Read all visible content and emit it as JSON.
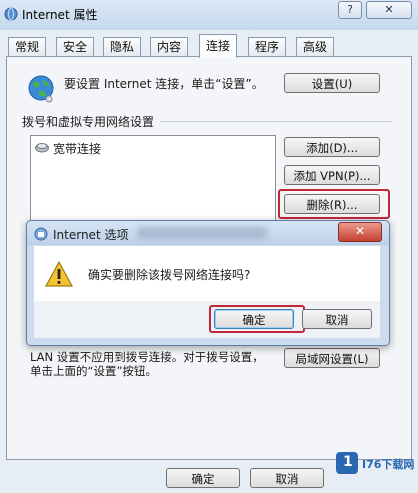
{
  "window": {
    "title": "Internet 属性",
    "help_glyph": "?",
    "close_glyph": "✕"
  },
  "tabs": [
    {
      "label": "常规"
    },
    {
      "label": "安全"
    },
    {
      "label": "隐私"
    },
    {
      "label": "内容"
    },
    {
      "label": "连接"
    },
    {
      "label": "程序"
    },
    {
      "label": "高级"
    }
  ],
  "connection": {
    "setup_text": "要设置 Internet 连接，单击“设置”。",
    "setup_button": "设置(U)",
    "dialup_group_label": "拨号和虚拟专用网络设置",
    "list_items": [
      "宽带连接"
    ],
    "add_button": "添加(D)...",
    "add_vpn_button": "添加 VPN(P)...",
    "remove_button": "删除(R)...",
    "lan_text": "LAN 设置不应用到拨号连接。对于拨号设置，单击上面的“设置”按钮。",
    "lan_button": "局域网设置(L)"
  },
  "footer": {
    "ok_button": "确定",
    "cancel_button": "取消"
  },
  "dialog": {
    "title": "Internet 选项",
    "close_glyph": "✕",
    "message": "确实要删除该拨号网络连接吗?",
    "ok_button": "确定",
    "cancel_button": "取消"
  },
  "watermark": {
    "brand": "I76下载网",
    "logo_letter": "1"
  },
  "colors": {
    "highlight": "#c0283a",
    "accent": "#3670b8"
  }
}
